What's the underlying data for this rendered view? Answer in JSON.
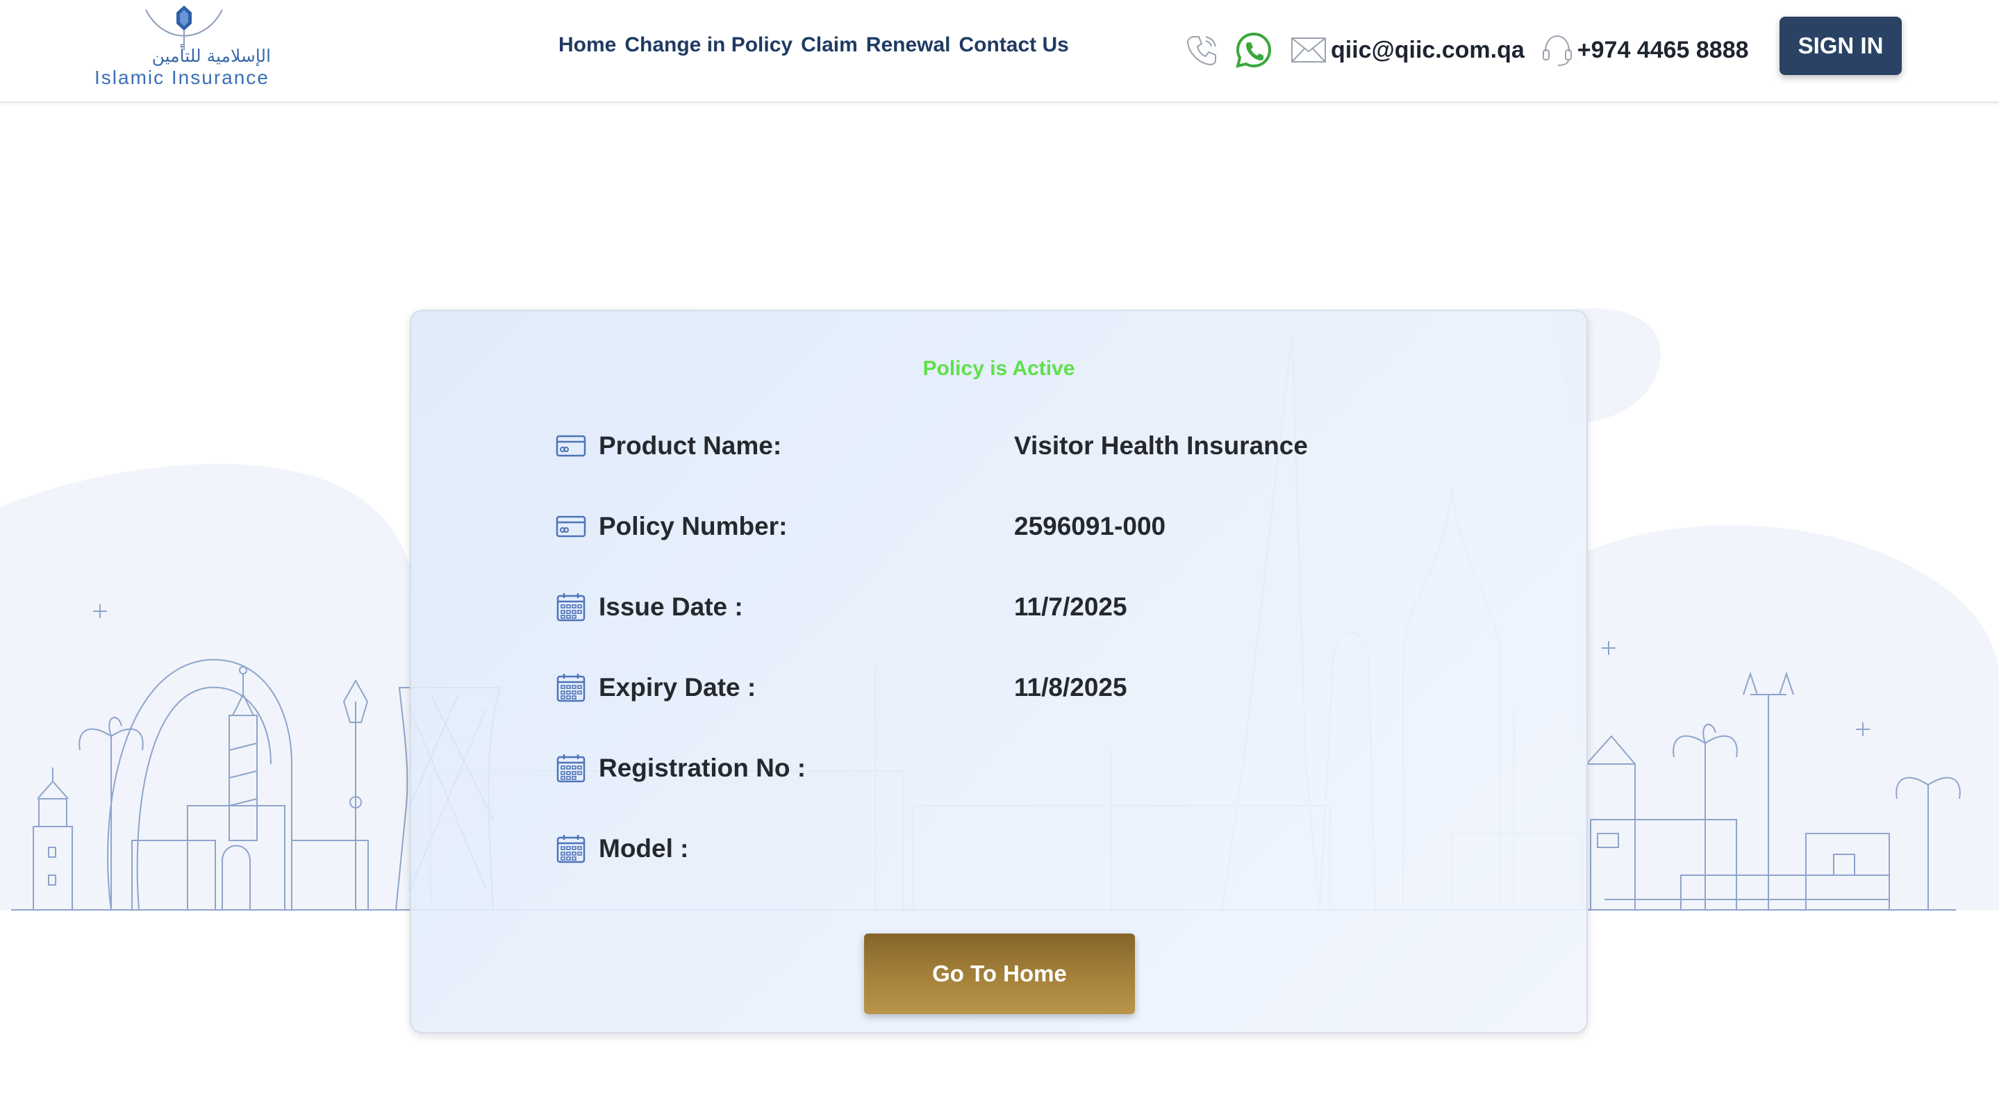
{
  "brand": {
    "name_en": "Islamic Insurance",
    "name_ar": "الإسلامية للتأمين"
  },
  "nav": {
    "items": [
      {
        "label": "Home"
      },
      {
        "label": "Change in Policy"
      },
      {
        "label": "Claim"
      },
      {
        "label": "Renewal"
      },
      {
        "label": "Contact Us"
      }
    ]
  },
  "contact": {
    "email": "qiic@qiic.com.qa",
    "phone": "+974 4465 8888"
  },
  "header": {
    "signin_label": "SIGN IN"
  },
  "policy": {
    "status": "Policy is Active",
    "rows": [
      {
        "label": "Product Name:",
        "value": "Visitor Health Insurance",
        "icon": "card-icon"
      },
      {
        "label": "Policy Number:",
        "value": "2596091-000",
        "icon": "card-icon"
      },
      {
        "label": "Issue Date :",
        "value": "11/7/2025",
        "icon": "calendar-icon"
      },
      {
        "label": "Expiry Date :",
        "value": "11/8/2025",
        "icon": "calendar-icon"
      },
      {
        "label": "Registration No :",
        "value": "",
        "icon": "calendar-icon"
      },
      {
        "label": "Model :",
        "value": "",
        "icon": "calendar-icon"
      }
    ],
    "go_home_label": "Go To Home"
  },
  "colors": {
    "navy": "#1f3b63",
    "signin_bg": "#2a4263",
    "status_green": "#5ee04a",
    "gold": "#a8843c",
    "line_art": "#8ea4cc"
  }
}
